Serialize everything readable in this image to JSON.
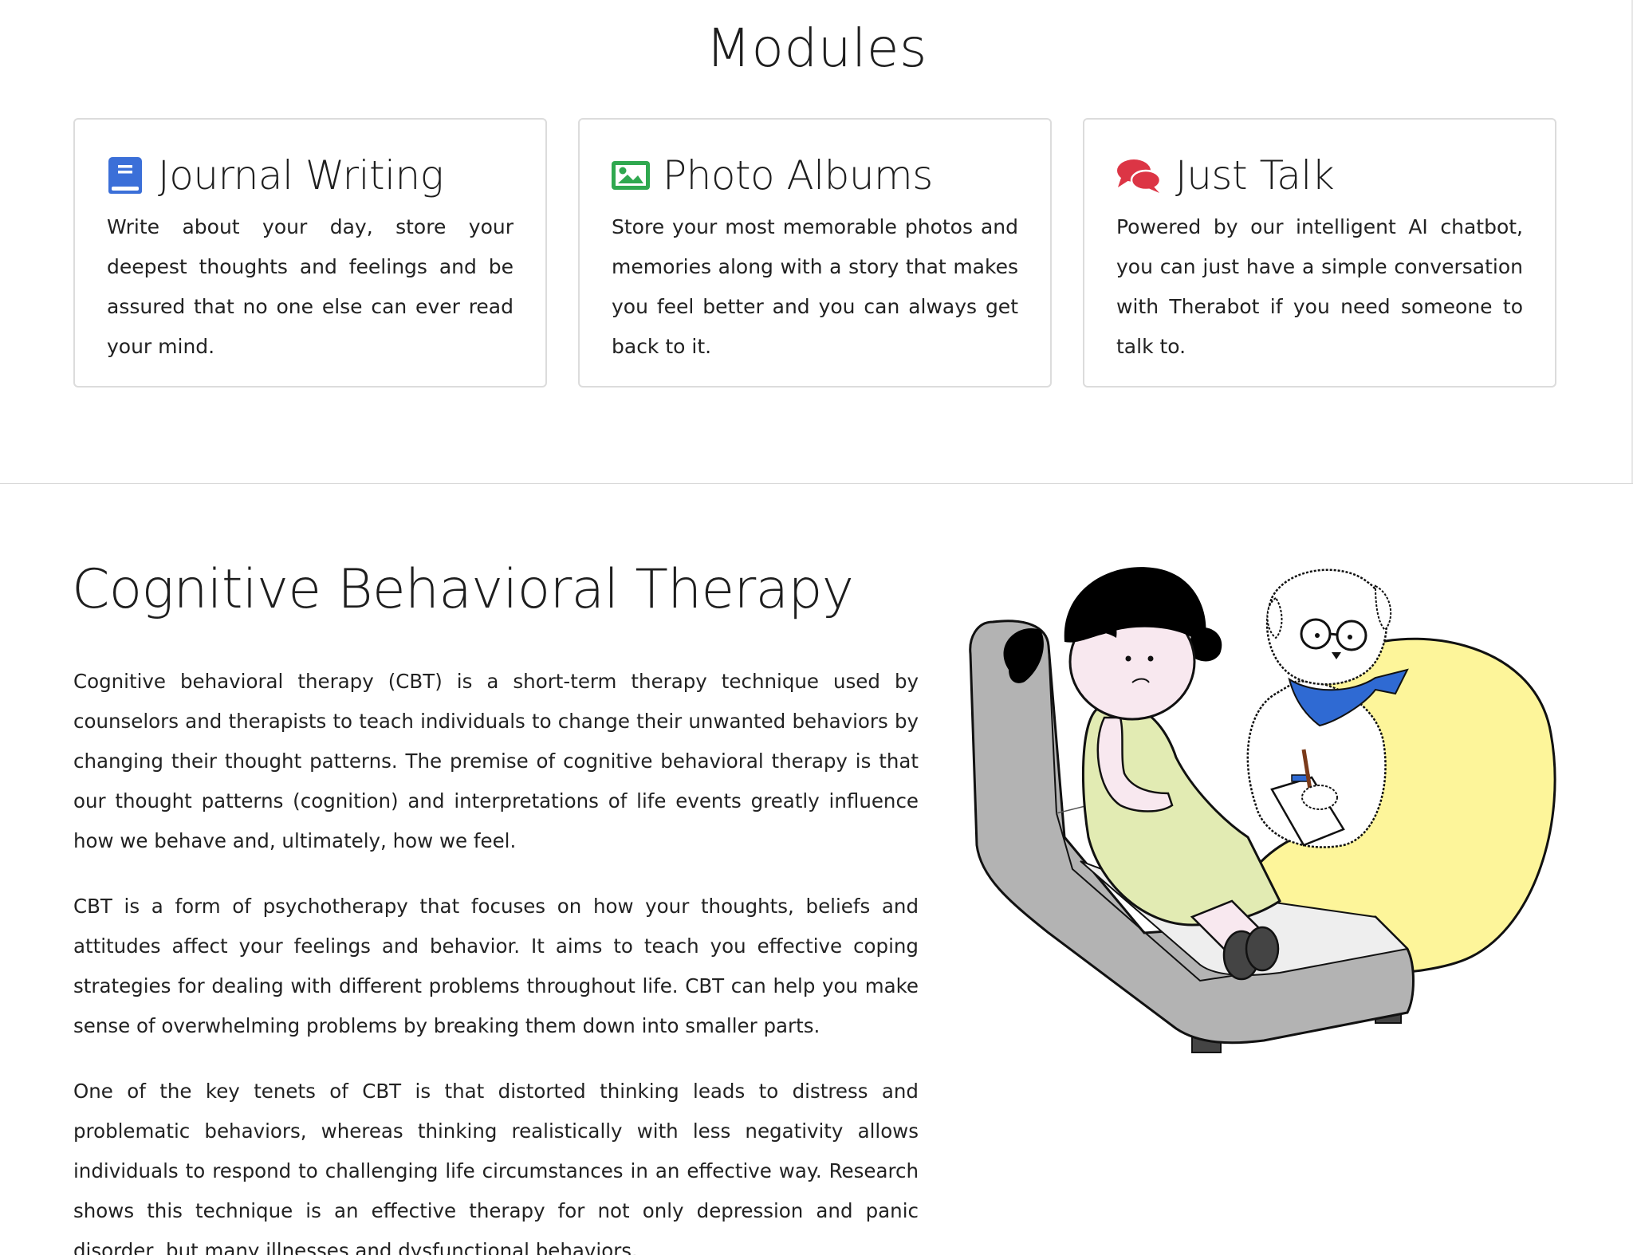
{
  "modules": {
    "heading": "Modules",
    "cards": [
      {
        "icon": "book-icon",
        "title": "Journal Writing",
        "description": "Write about your day, store your deepest thoughts and feelings and be assured that no one else can ever read your mind.",
        "icon_color": "#3b6fd8"
      },
      {
        "icon": "image-icon",
        "title": "Photo Albums",
        "description": "Store your most memorable photos and memories along with a story that makes you feel better and you can always get back to it.",
        "icon_color": "#2fa84f"
      },
      {
        "icon": "comments-icon",
        "title": "Just Talk",
        "description": "Powered by our intelligent AI chatbot, you can just have a simple conversation with Therabot if you need someone to talk to.",
        "icon_color": "#dc3545"
      }
    ]
  },
  "cbt": {
    "heading": "Cognitive Behavioral Therapy",
    "paragraphs": [
      "Cognitive behavioral therapy (CBT) is a short-term therapy technique used by counselors and therapists to teach individuals to change their unwanted behaviors by changing their thought patterns. The premise of cognitive behavioral therapy is that our thought patterns (cognition) and interpretations of life events greatly influence how we behave and, ultimately, how we feel.",
      "CBT is a form of psychotherapy that focuses on how your thoughts, beliefs and attitudes affect your feelings and behavior. It aims to teach you effective coping strategies for dealing with different problems throughout life. CBT can help you make sense of overwhelming problems by breaking them down into smaller parts.",
      "One of the key tenets of CBT is that distorted thinking leads to distress and problematic behaviors, whereas thinking realistically with less negativity allows individuals to respond to challenging life circumstances in an effective way. Research shows this technique is an effective therapy for not only depression and panic disorder, but many illnesses and dysfunctional behaviors."
    ],
    "illustration": "therapy-session-illustration"
  }
}
